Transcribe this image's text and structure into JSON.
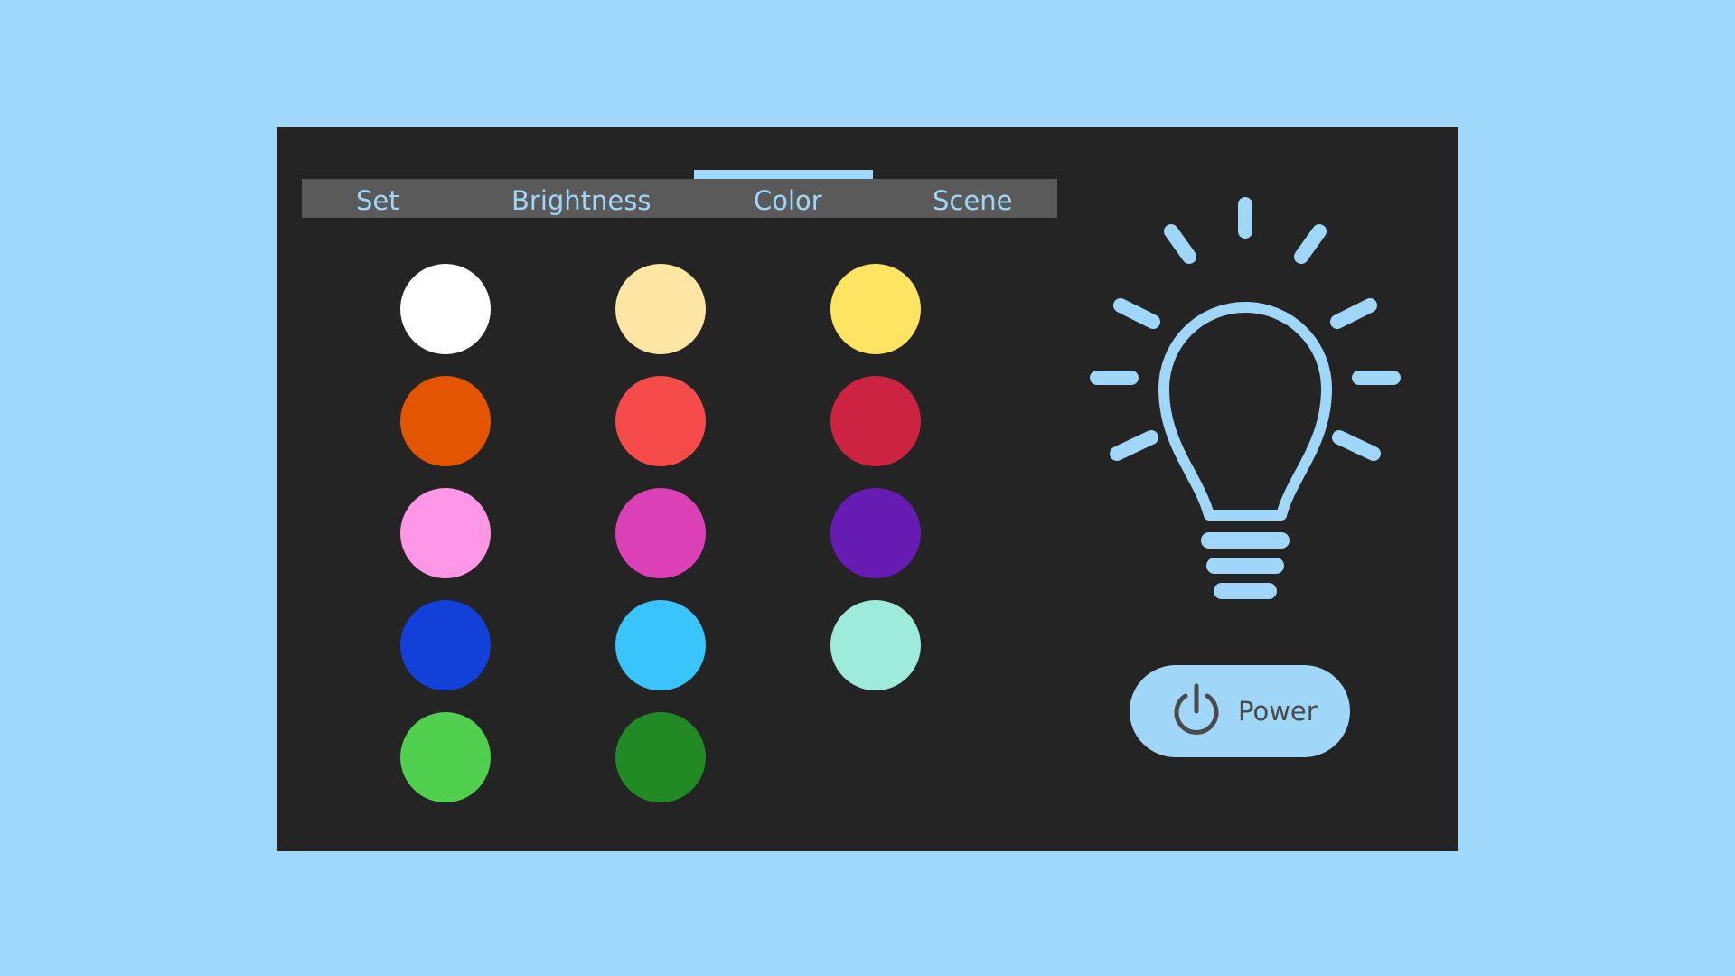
{
  "tabs": [
    {
      "label": "Set"
    },
    {
      "label": "Brightness"
    },
    {
      "label": "Color",
      "active": true
    },
    {
      "label": "Scene"
    }
  ],
  "colors": {
    "background": "#a0d8fb",
    "panel": "#242424",
    "tabbar": "#5a5a5a",
    "accent": "#a0d6f8"
  },
  "swatches": [
    {
      "name": "white",
      "color": "#ffffff"
    },
    {
      "name": "warm-white",
      "color": "#ffe6a4"
    },
    {
      "name": "yellow",
      "color": "#ffe463"
    },
    {
      "name": "orange",
      "color": "#e35500"
    },
    {
      "name": "coral-red",
      "color": "#f64b4b"
    },
    {
      "name": "crimson",
      "color": "#cc2440"
    },
    {
      "name": "pink",
      "color": "#ff96e6"
    },
    {
      "name": "magenta",
      "color": "#dc40b6"
    },
    {
      "name": "purple",
      "color": "#661bb2"
    },
    {
      "name": "royal-blue",
      "color": "#1240d8"
    },
    {
      "name": "sky-blue",
      "color": "#3ac4fc"
    },
    {
      "name": "mint",
      "color": "#9eebdc"
    },
    {
      "name": "green",
      "color": "#50d04e"
    },
    {
      "name": "dark-green",
      "color": "#218a24"
    }
  ],
  "bulb": {
    "icon": "lightbulb-icon"
  },
  "power": {
    "label": "Power",
    "icon": "power-icon"
  }
}
